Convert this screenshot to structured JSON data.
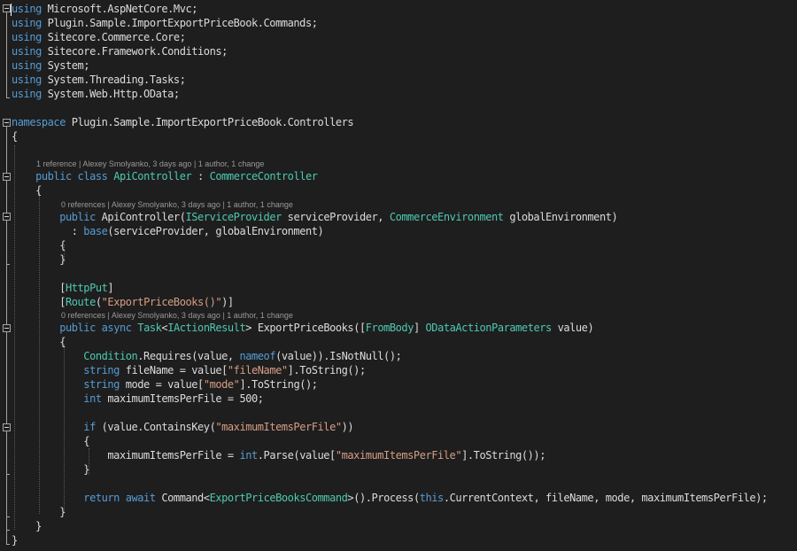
{
  "colors": {
    "background": "#1e1e1e",
    "keyword": "#569cd6",
    "type": "#4ec9b0",
    "string": "#d69d85",
    "text": "#dcdcdc",
    "codelens": "#999999"
  },
  "code": {
    "l1": [
      {
        "c": "kw",
        "t": "using"
      },
      {
        "c": "tx",
        "t": " Microsoft.AspNetCore.Mvc;"
      }
    ],
    "l2": [
      {
        "c": "kw",
        "t": "using"
      },
      {
        "c": "tx",
        "t": " Plugin.Sample.ImportExportPriceBook.Commands;"
      }
    ],
    "l3": [
      {
        "c": "kw",
        "t": "using"
      },
      {
        "c": "tx",
        "t": " Sitecore.Commerce.Core;"
      }
    ],
    "l4": [
      {
        "c": "kw",
        "t": "using"
      },
      {
        "c": "tx",
        "t": " Sitecore.Framework.Conditions;"
      }
    ],
    "l5": [
      {
        "c": "kw",
        "t": "using"
      },
      {
        "c": "tx",
        "t": " System;"
      }
    ],
    "l6": [
      {
        "c": "kw",
        "t": "using"
      },
      {
        "c": "tx",
        "t": " System.Threading.Tasks;"
      }
    ],
    "l7": [
      {
        "c": "kw",
        "t": "using"
      },
      {
        "c": "tx",
        "t": " System.Web.Http.OData;"
      }
    ],
    "l9": [
      {
        "c": "kw",
        "t": "namespace"
      },
      {
        "c": "tx",
        "t": " Plugin.Sample.ImportExportPriceBook.Controllers"
      }
    ],
    "l10": [
      {
        "c": "tx",
        "t": "{"
      }
    ],
    "l12": [
      {
        "c": "tx",
        "t": "    "
      },
      {
        "c": "kw",
        "t": "public"
      },
      {
        "c": "tx",
        "t": " "
      },
      {
        "c": "kw",
        "t": "class"
      },
      {
        "c": "tx",
        "t": " "
      },
      {
        "c": "ty",
        "t": "ApiController"
      },
      {
        "c": "tx",
        "t": " : "
      },
      {
        "c": "ty",
        "t": "CommerceController"
      }
    ],
    "l13": [
      {
        "c": "tx",
        "t": "    {"
      }
    ],
    "l15": [
      {
        "c": "tx",
        "t": "        "
      },
      {
        "c": "kw",
        "t": "public"
      },
      {
        "c": "tx",
        "t": " ApiController("
      },
      {
        "c": "ty",
        "t": "IServiceProvider"
      },
      {
        "c": "tx",
        "t": " serviceProvider, "
      },
      {
        "c": "ty",
        "t": "CommerceEnvironment"
      },
      {
        "c": "tx",
        "t": " globalEnvironment)"
      }
    ],
    "l16": [
      {
        "c": "tx",
        "t": "          : "
      },
      {
        "c": "kw",
        "t": "base"
      },
      {
        "c": "tx",
        "t": "(serviceProvider, globalEnvironment)"
      }
    ],
    "l17": [
      {
        "c": "tx",
        "t": "        {"
      }
    ],
    "l18": [
      {
        "c": "tx",
        "t": "        }"
      }
    ],
    "l20": [
      {
        "c": "tx",
        "t": "        ["
      },
      {
        "c": "ty",
        "t": "HttpPut"
      },
      {
        "c": "tx",
        "t": "]"
      }
    ],
    "l21": [
      {
        "c": "tx",
        "t": "        ["
      },
      {
        "c": "ty",
        "t": "Route"
      },
      {
        "c": "tx",
        "t": "("
      },
      {
        "c": "st",
        "t": "\"ExportPriceBooks()\""
      },
      {
        "c": "tx",
        "t": ")]"
      }
    ],
    "l23": [
      {
        "c": "tx",
        "t": "        "
      },
      {
        "c": "kw",
        "t": "public"
      },
      {
        "c": "tx",
        "t": " "
      },
      {
        "c": "kw",
        "t": "async"
      },
      {
        "c": "tx",
        "t": " "
      },
      {
        "c": "ty",
        "t": "Task"
      },
      {
        "c": "tx",
        "t": "<"
      },
      {
        "c": "ty",
        "t": "IActionResult"
      },
      {
        "c": "tx",
        "t": "> ExportPriceBooks(["
      },
      {
        "c": "ty",
        "t": "FromBody"
      },
      {
        "c": "tx",
        "t": "] "
      },
      {
        "c": "ty",
        "t": "ODataActionParameters"
      },
      {
        "c": "tx",
        "t": " value)"
      }
    ],
    "l24": [
      {
        "c": "tx",
        "t": "        {"
      }
    ],
    "l25": [
      {
        "c": "tx",
        "t": "            "
      },
      {
        "c": "ty",
        "t": "Condition"
      },
      {
        "c": "tx",
        "t": ".Requires(value, "
      },
      {
        "c": "kw",
        "t": "nameof"
      },
      {
        "c": "tx",
        "t": "(value)).IsNotNull();"
      }
    ],
    "l26": [
      {
        "c": "tx",
        "t": "            "
      },
      {
        "c": "kw",
        "t": "string"
      },
      {
        "c": "tx",
        "t": " fileName = value["
      },
      {
        "c": "st",
        "t": "\"fileName\""
      },
      {
        "c": "tx",
        "t": "].ToString();"
      }
    ],
    "l27": [
      {
        "c": "tx",
        "t": "            "
      },
      {
        "c": "kw",
        "t": "string"
      },
      {
        "c": "tx",
        "t": " mode = value["
      },
      {
        "c": "st",
        "t": "\"mode\""
      },
      {
        "c": "tx",
        "t": "].ToString();"
      }
    ],
    "l28": [
      {
        "c": "tx",
        "t": "            "
      },
      {
        "c": "kw",
        "t": "int"
      },
      {
        "c": "tx",
        "t": " maximumItemsPerFile = 500;"
      }
    ],
    "l30": [
      {
        "c": "tx",
        "t": "            "
      },
      {
        "c": "kw",
        "t": "if"
      },
      {
        "c": "tx",
        "t": " (value.ContainsKey("
      },
      {
        "c": "st",
        "t": "\"maximumItemsPerFile\""
      },
      {
        "c": "tx",
        "t": "))"
      }
    ],
    "l31": [
      {
        "c": "tx",
        "t": "            {"
      }
    ],
    "l32": [
      {
        "c": "tx",
        "t": "                maximumItemsPerFile = "
      },
      {
        "c": "kw",
        "t": "int"
      },
      {
        "c": "tx",
        "t": ".Parse(value["
      },
      {
        "c": "st",
        "t": "\"maximumItemsPerFile\""
      },
      {
        "c": "tx",
        "t": "].ToString());"
      }
    ],
    "l33": [
      {
        "c": "tx",
        "t": "            }"
      }
    ],
    "l35": [
      {
        "c": "tx",
        "t": "            "
      },
      {
        "c": "kw",
        "t": "return"
      },
      {
        "c": "tx",
        "t": " "
      },
      {
        "c": "kw",
        "t": "await"
      },
      {
        "c": "tx",
        "t": " Command<"
      },
      {
        "c": "ty",
        "t": "ExportPriceBooksCommand"
      },
      {
        "c": "tx",
        "t": ">().Process("
      },
      {
        "c": "kw",
        "t": "this"
      },
      {
        "c": "tx",
        "t": ".CurrentContext, fileName, mode, maximumItemsPerFile);"
      }
    ],
    "l36": [
      {
        "c": "tx",
        "t": "        }"
      }
    ],
    "l37": [
      {
        "c": "tx",
        "t": "    }"
      }
    ],
    "l38": [
      {
        "c": "tx",
        "t": "}"
      }
    ]
  },
  "codelens": {
    "class": "1 reference | Alexey Smolyanko, 3 days ago | 1 author, 1 change",
    "constructor": "0 references | Alexey Smolyanko, 3 days ago | 1 author, 1 change",
    "method": "0 references | Alexey Smolyanko, 3 days ago | 1 author, 1 change"
  }
}
